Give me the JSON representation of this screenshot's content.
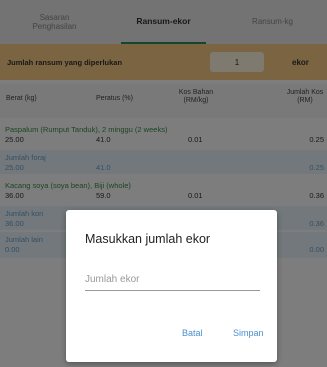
{
  "tabs": [
    {
      "label": "Sasaran Penghasilan",
      "active": false
    },
    {
      "label": "Ransum-ekor",
      "active": true
    },
    {
      "label": "Ransum-kg",
      "active": false
    }
  ],
  "quantity_row": {
    "label": "Jumlah ransum yang diperlukan",
    "value": "1",
    "unit": "ekor"
  },
  "table_header": {
    "weight": "Berat (kg)",
    "percent": "Peratus (%)",
    "cost": "Kos Bahan (RM/kg)",
    "total": "Jumlah Kos (RM)"
  },
  "rows": [
    {
      "type": "ingredient",
      "title": "Paspalum (Rumput Tanduk), 2 minggu (2 weeks)",
      "weight": "25.00",
      "percent": "41.0",
      "cost": "0.01",
      "total": "0.25"
    },
    {
      "type": "summary",
      "title": "Jumlah foraj",
      "weight": "25.00",
      "percent": "41.0",
      "cost": "",
      "total": "0.25"
    },
    {
      "type": "ingredient",
      "title": "Kacang soya (soya bean), Biji (whole)",
      "weight": "36.00",
      "percent": "59.0",
      "cost": "0.01",
      "total": "0.36"
    },
    {
      "type": "summary",
      "title": "Jumlah kon",
      "weight": "36.00",
      "percent": "",
      "cost": "",
      "total": "0.36"
    },
    {
      "type": "summary",
      "title": "Jumlah lain",
      "weight": "0.00",
      "percent": "",
      "cost": "",
      "total": "0.00"
    }
  ],
  "dialog": {
    "title": "Masukkan jumlah ekor",
    "placeholder": "Jumlah ekor",
    "cancel_label": "Batal",
    "save_label": "Simpan"
  }
}
